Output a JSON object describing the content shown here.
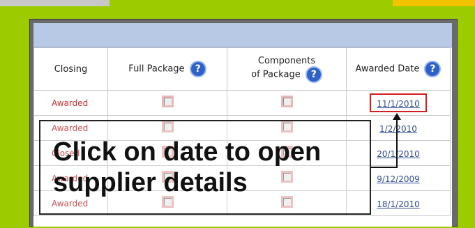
{
  "table": {
    "headers": {
      "closing": "Closing",
      "full_package": "Full Package",
      "components_line1": "Components",
      "components_line2": "of Package",
      "awarded_date": "Awarded Date"
    },
    "help_glyph": "?",
    "rows": [
      {
        "closing": "Awarded",
        "date": "11/1/2010"
      },
      {
        "closing": "Awarded",
        "date": "1/2/2010"
      },
      {
        "closing": "Closed",
        "date": "20/1/2010"
      },
      {
        "closing": "Awarded",
        "date": "9/12/2009"
      },
      {
        "closing": "Awarded",
        "date": "18/1/2010"
      }
    ]
  },
  "callout": {
    "line1": "Click on date to open",
    "line2": "supplier details"
  },
  "colors": {
    "background": "#9ccc00",
    "header_bar": "#b7c9e4",
    "status_text": "#cc3333",
    "link": "#334d99",
    "highlight_box": "#d02020"
  }
}
